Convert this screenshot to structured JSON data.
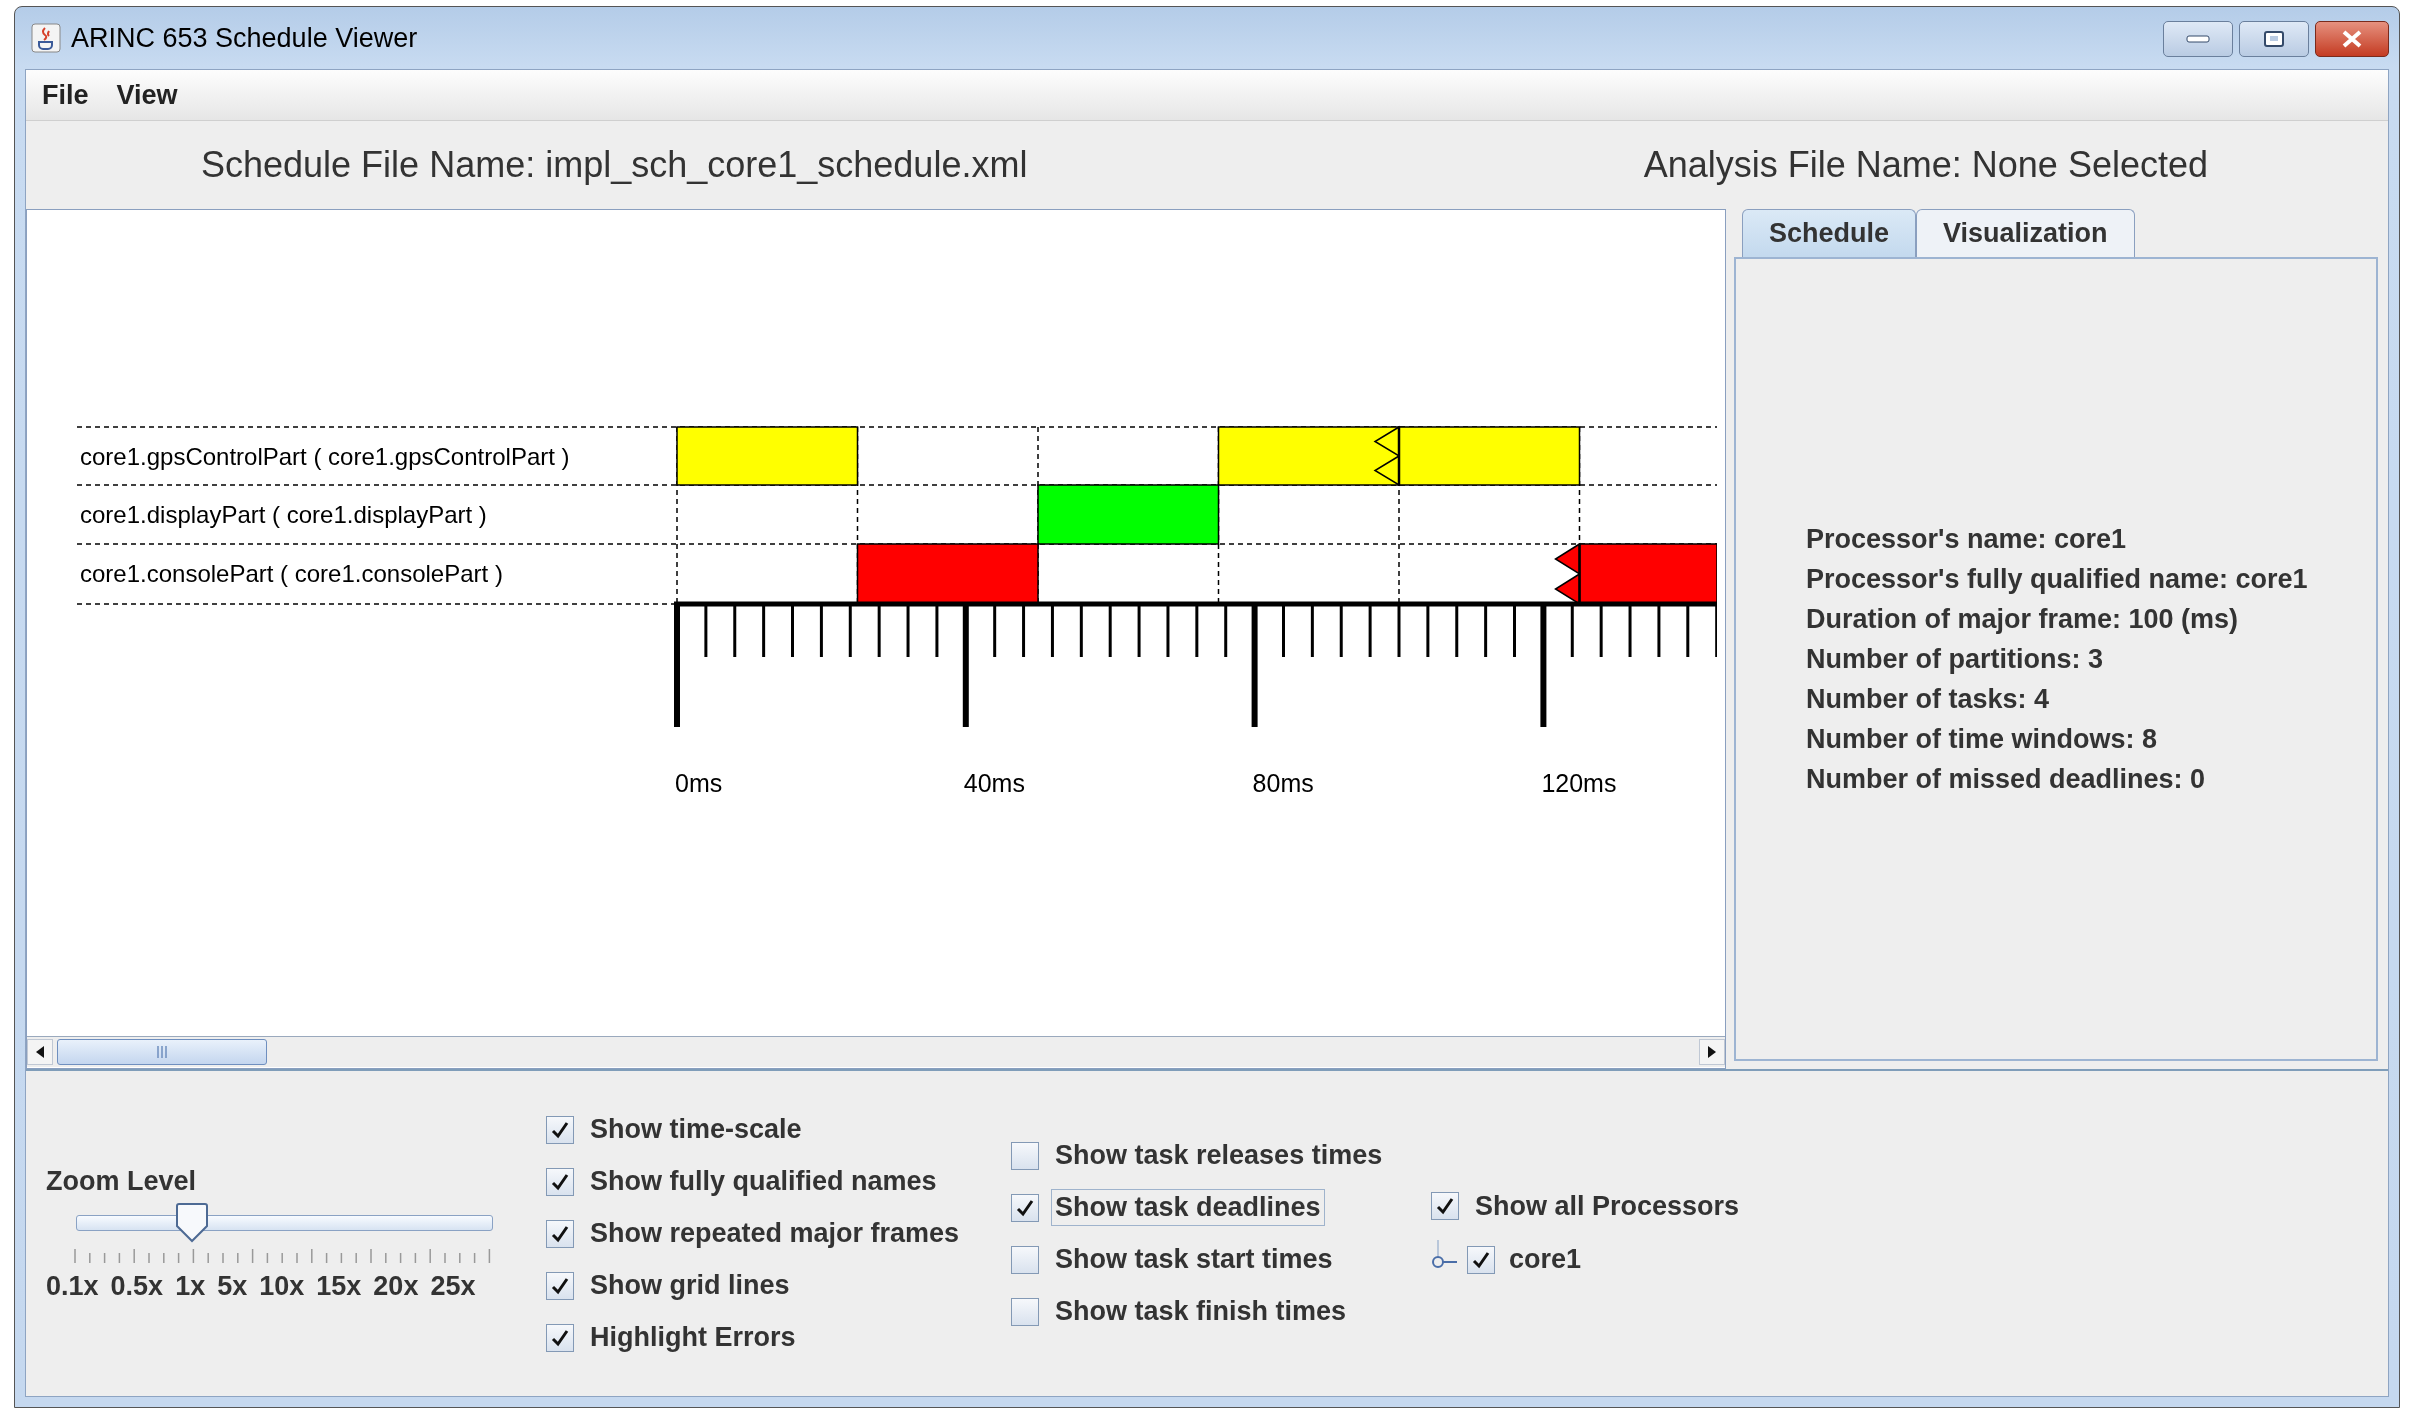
{
  "window": {
    "title": "ARINC 653 Schedule Viewer"
  },
  "menu": [
    "File",
    "View"
  ],
  "header": {
    "schedule_file": "Schedule File Name: impl_sch_core1_schedule.xml",
    "analysis_file": "Analysis File Name: None Selected"
  },
  "schedule": {
    "rows": [
      {
        "label": "core1.gpsControlPart ( core1.gpsControlPart )",
        "color": "#ffff00",
        "slots": [
          {
            "kind": "busy"
          },
          {
            "kind": "idle"
          },
          {
            "kind": "idle"
          },
          {
            "kind": "busy_deadline"
          },
          {
            "kind": "busy"
          },
          {
            "kind": "idle"
          }
        ]
      },
      {
        "label": "core1.displayPart ( core1.displayPart )",
        "color": "#00ff00",
        "slots": [
          {
            "kind": "idle"
          },
          {
            "kind": "idle"
          },
          {
            "kind": "busy"
          },
          {
            "kind": "idle"
          },
          {
            "kind": "idle"
          },
          {
            "kind": "idle"
          }
        ]
      },
      {
        "label": "core1.consolePart ( core1.consolePart )",
        "color": "#ff0000",
        "slots": [
          {
            "kind": "idle"
          },
          {
            "kind": "busy"
          },
          {
            "kind": "idle"
          },
          {
            "kind": "idle"
          },
          {
            "kind": "idle_deadline"
          },
          {
            "kind": "busy"
          }
        ]
      }
    ],
    "axis_labels": [
      "0ms",
      "40ms",
      "80ms",
      "120ms"
    ]
  },
  "tabs": [
    {
      "label": "Schedule",
      "selected": true
    },
    {
      "label": "Visualization",
      "selected": false
    }
  ],
  "info_lines": [
    "Processor's name: core1",
    "Processor's fully qualified name: core1",
    "Duration of major frame: 100 (ms)",
    "Number of partitions: 3",
    "Number of tasks: 4",
    "Number of time windows: 8",
    "Number of missed deadlines: 0"
  ],
  "zoom": {
    "label": "Zoom Level",
    "level": 0.28,
    "marks": [
      "0.1x",
      "0.5x",
      "1x",
      "5x",
      "10x",
      "15x",
      "20x",
      "25x"
    ]
  },
  "options": [
    [
      {
        "label": "Show time-scale",
        "checked": true,
        "focused": false
      },
      {
        "label": "Show fully qualified names",
        "checked": true,
        "focused": false
      },
      {
        "label": "Show repeated major frames",
        "checked": true,
        "focused": false
      },
      {
        "label": "Show grid lines",
        "checked": true,
        "focused": false
      },
      {
        "label": "Highlight Errors",
        "checked": true,
        "focused": false
      }
    ],
    [
      {
        "label": "Show task releases times",
        "checked": false,
        "focused": false
      },
      {
        "label": "Show task deadlines",
        "checked": true,
        "focused": true
      },
      {
        "label": "Show task start times",
        "checked": false,
        "focused": false
      },
      {
        "label": "Show task finish times",
        "checked": false,
        "focused": false
      }
    ]
  ],
  "processors": {
    "label": "Show all Processors",
    "checked": true,
    "children": [
      {
        "label": "core1",
        "checked": true
      }
    ]
  }
}
